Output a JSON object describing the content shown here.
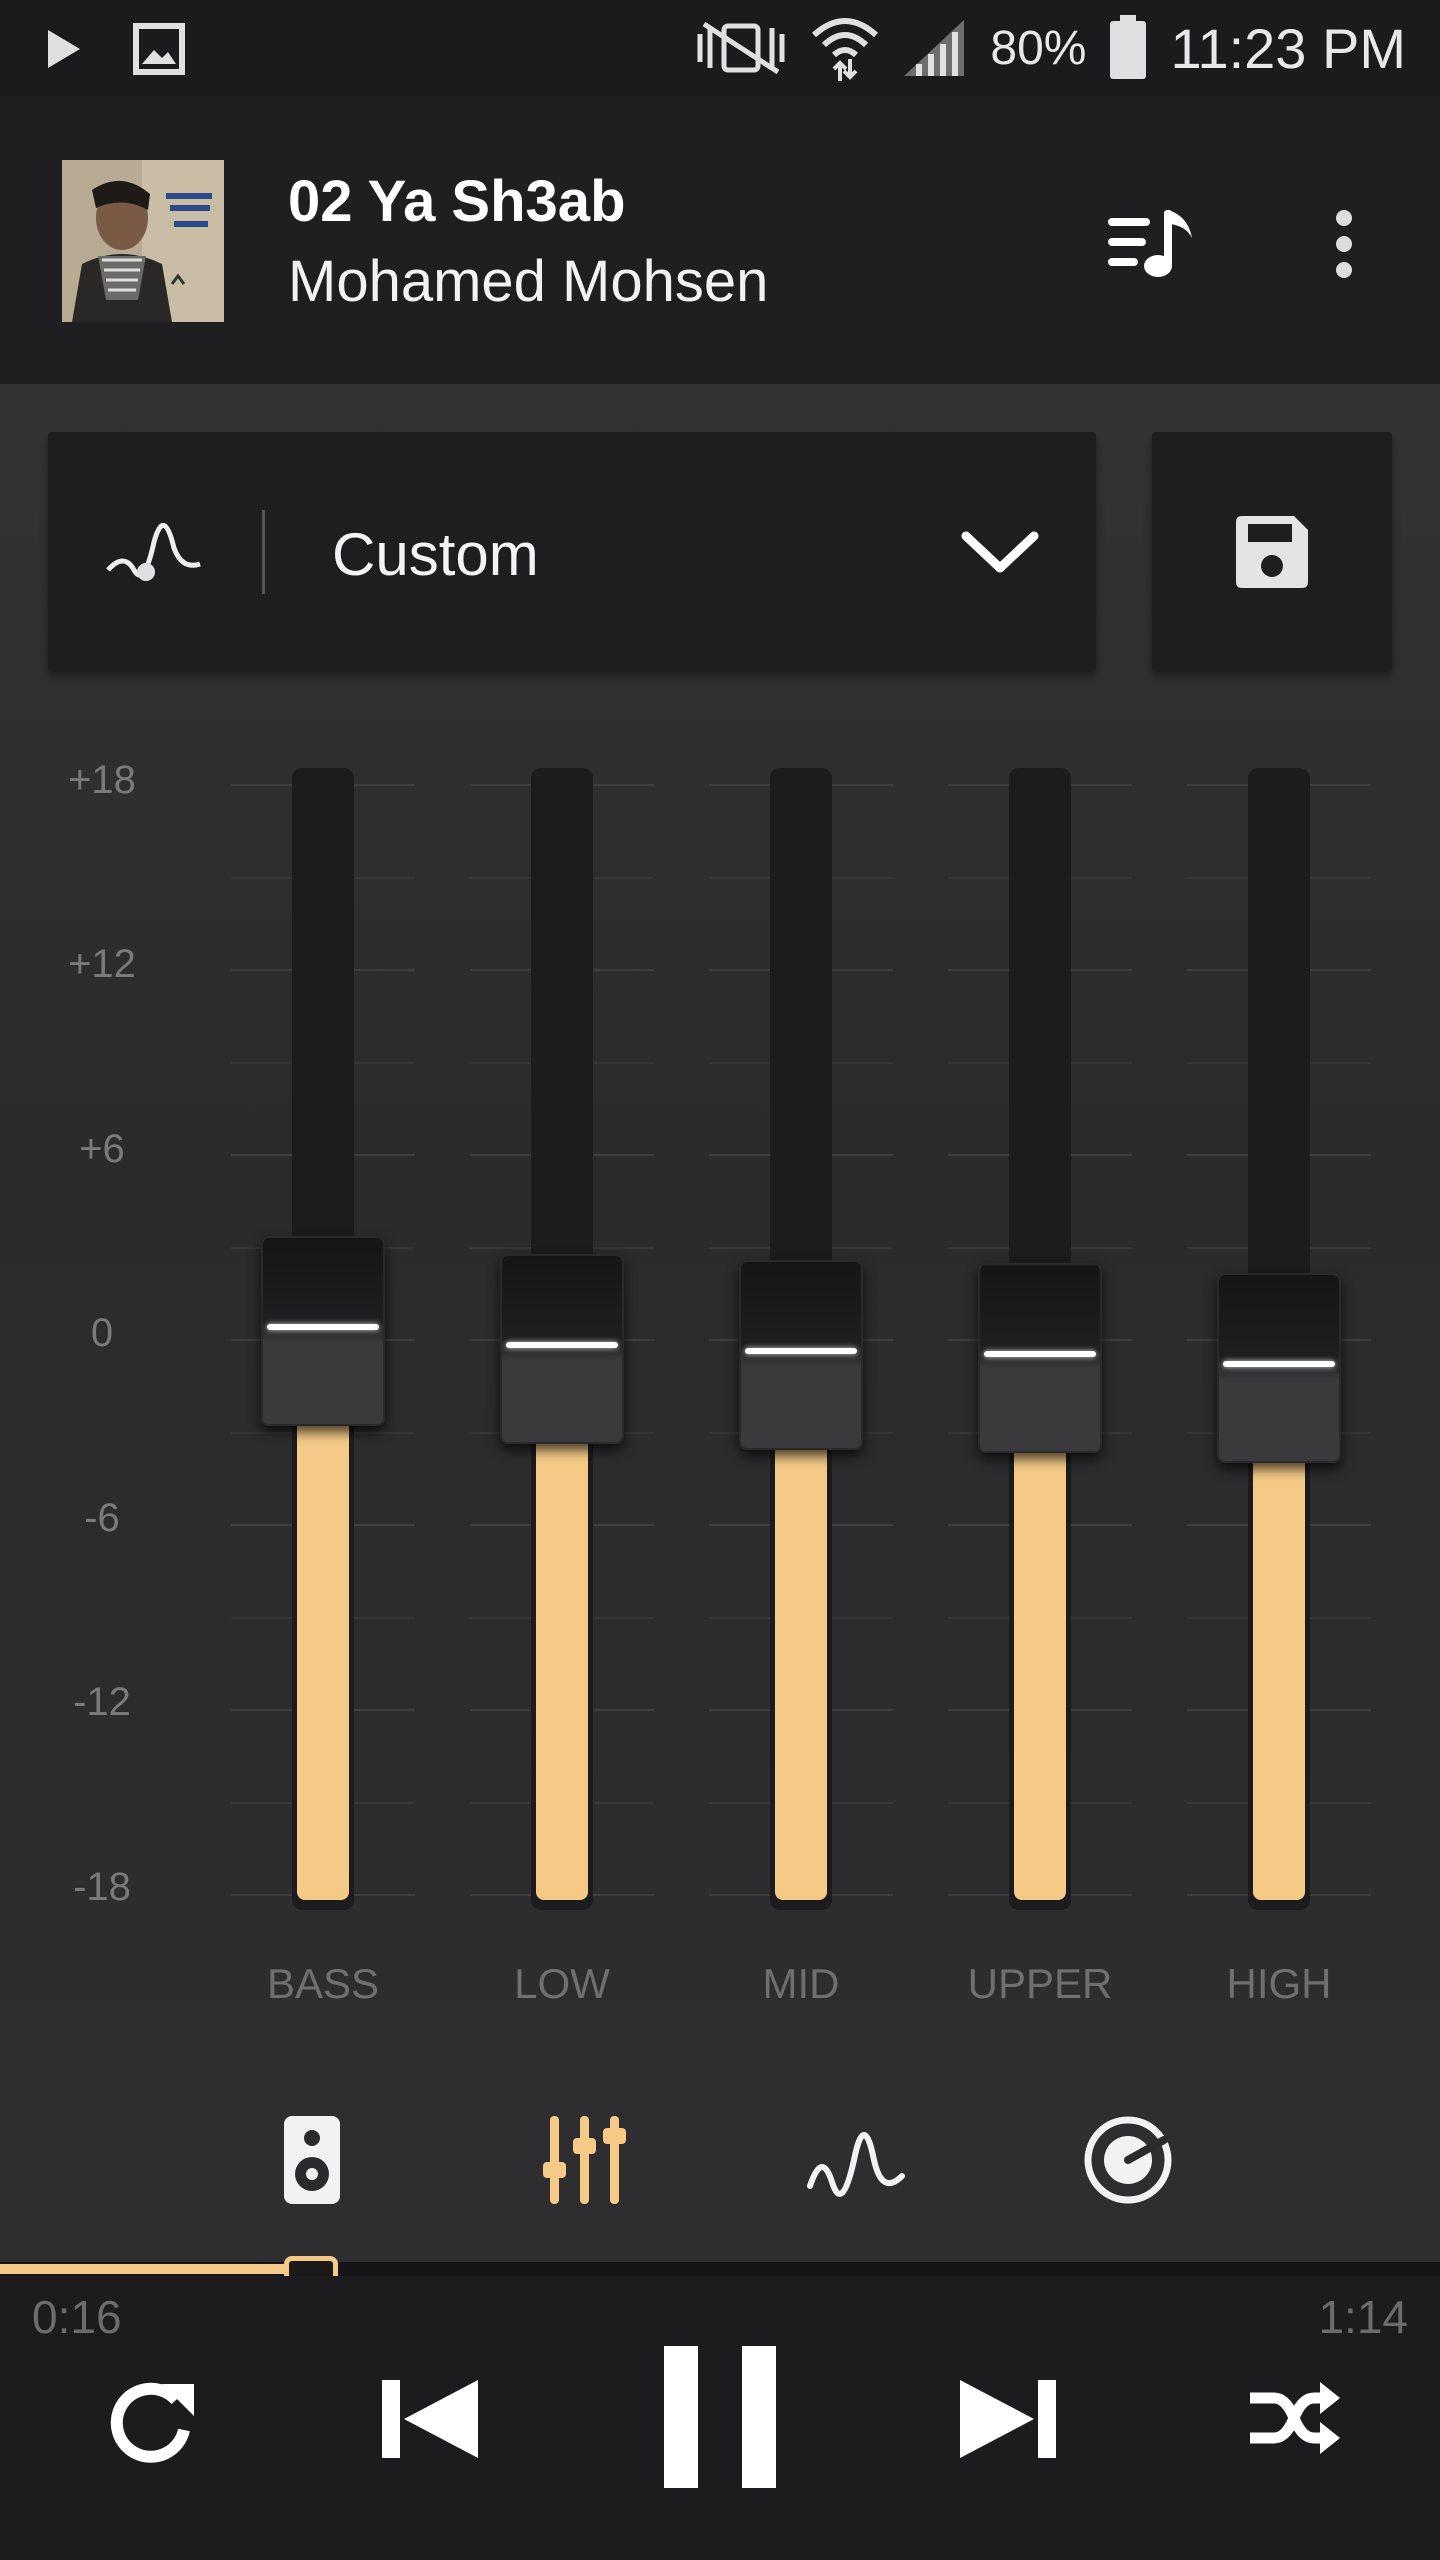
{
  "status_bar": {
    "left_icons": [
      "play-icon",
      "image-icon"
    ],
    "right_icons": [
      "mute-vibrate-icon",
      "wifi-icon",
      "signal-icon",
      "battery-icon"
    ],
    "battery": "80%",
    "time": "11:23 PM"
  },
  "now_playing": {
    "title": "02 Ya Sh3ab",
    "artist": "Mohamed Mohsen",
    "album_art": "album-art",
    "actions": [
      "queue-icon",
      "more-icon"
    ]
  },
  "preset": {
    "icon": "preset-curve-icon",
    "label": "Custom",
    "dropdown_icon": "chevron-down-icon",
    "save_icon": "save-icon"
  },
  "equalizer": {
    "db_labels": [
      "+18",
      "+12",
      "+6",
      "0",
      "-6",
      "-12",
      "-18"
    ],
    "bands": [
      {
        "label": "BASS",
        "value_db": 0.4
      },
      {
        "label": "LOW",
        "value_db": -0.2
      },
      {
        "label": "MID",
        "value_db": -0.4
      },
      {
        "label": "UPPER",
        "value_db": -0.5
      },
      {
        "label": "HIGH",
        "value_db": -0.8
      }
    ]
  },
  "tabs": [
    {
      "name": "speaker-icon",
      "active": false
    },
    {
      "name": "equalizer-icon",
      "active": true
    },
    {
      "name": "waveform-icon",
      "active": false
    },
    {
      "name": "knob-icon",
      "active": false
    }
  ],
  "playback": {
    "elapsed": "0:16",
    "duration": "1:14",
    "progress": 0.216,
    "controls": [
      "repeat-icon",
      "previous-icon",
      "pause-icon",
      "next-icon",
      "shuffle-icon"
    ]
  },
  "colors": {
    "accent": "#f4ca86",
    "background": "#2a2a2c",
    "bar": "#1c1c1e"
  }
}
